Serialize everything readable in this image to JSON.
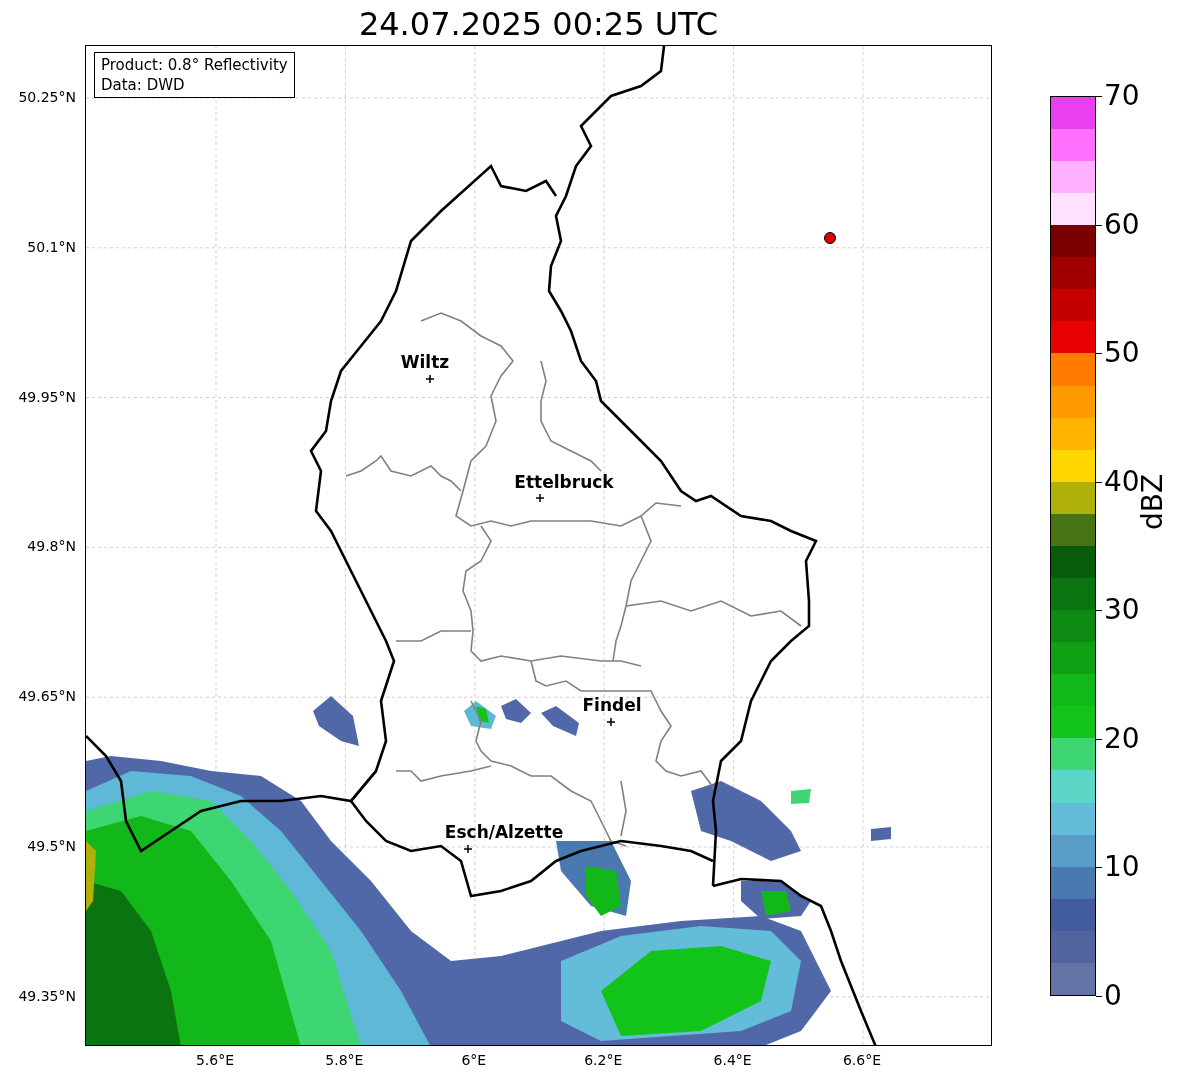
{
  "title": "24.07.2025 00:25 UTC",
  "legend": [
    "Product: 0.8° Reflectivity",
    "Data: DWD"
  ],
  "map": {
    "yticks": [
      "50.25°N",
      "50.1°N",
      "49.95°N",
      "49.8°N",
      "49.65°N",
      "49.5°N",
      "49.35°N"
    ],
    "xticks": [
      "5.6°E",
      "5.8°E",
      "6°E",
      "6.2°E",
      "6.4°E",
      "6.6°E"
    ],
    "cities": [
      {
        "name": "Wiltz"
      },
      {
        "name": "Ettelbruck"
      },
      {
        "name": "Findel"
      },
      {
        "name": "Esch/Alzette"
      }
    ]
  },
  "colorbar": {
    "label": "dBZ",
    "ticks": [
      "70",
      "60",
      "50",
      "40",
      "30",
      "20",
      "10",
      "0"
    ],
    "bands": [
      {
        "color": "#6473a6"
      },
      {
        "color": "#52649f"
      },
      {
        "color": "#435ca0"
      },
      {
        "color": "#4a79b0"
      },
      {
        "color": "#5a9cc8"
      },
      {
        "color": "#63bcd8"
      },
      {
        "color": "#5cd6c6"
      },
      {
        "color": "#3ed672"
      },
      {
        "color": "#12c41a"
      },
      {
        "color": "#10b81a"
      },
      {
        "color": "#0fa014"
      },
      {
        "color": "#0c8a12"
      },
      {
        "color": "#0a7410"
      },
      {
        "color": "#095c0c"
      },
      {
        "color": "#467412"
      },
      {
        "color": "#b0b00a"
      },
      {
        "color": "#ffd700"
      },
      {
        "color": "#ffb400"
      },
      {
        "color": "#ff9900"
      },
      {
        "color": "#ff7c00"
      },
      {
        "color": "#e60000"
      },
      {
        "color": "#c40000"
      },
      {
        "color": "#a00000"
      },
      {
        "color": "#7a0000"
      },
      {
        "color": "#ffe0ff"
      },
      {
        "color": "#ffb0ff"
      },
      {
        "color": "#ff70ff"
      },
      {
        "color": "#e840f0"
      }
    ]
  }
}
